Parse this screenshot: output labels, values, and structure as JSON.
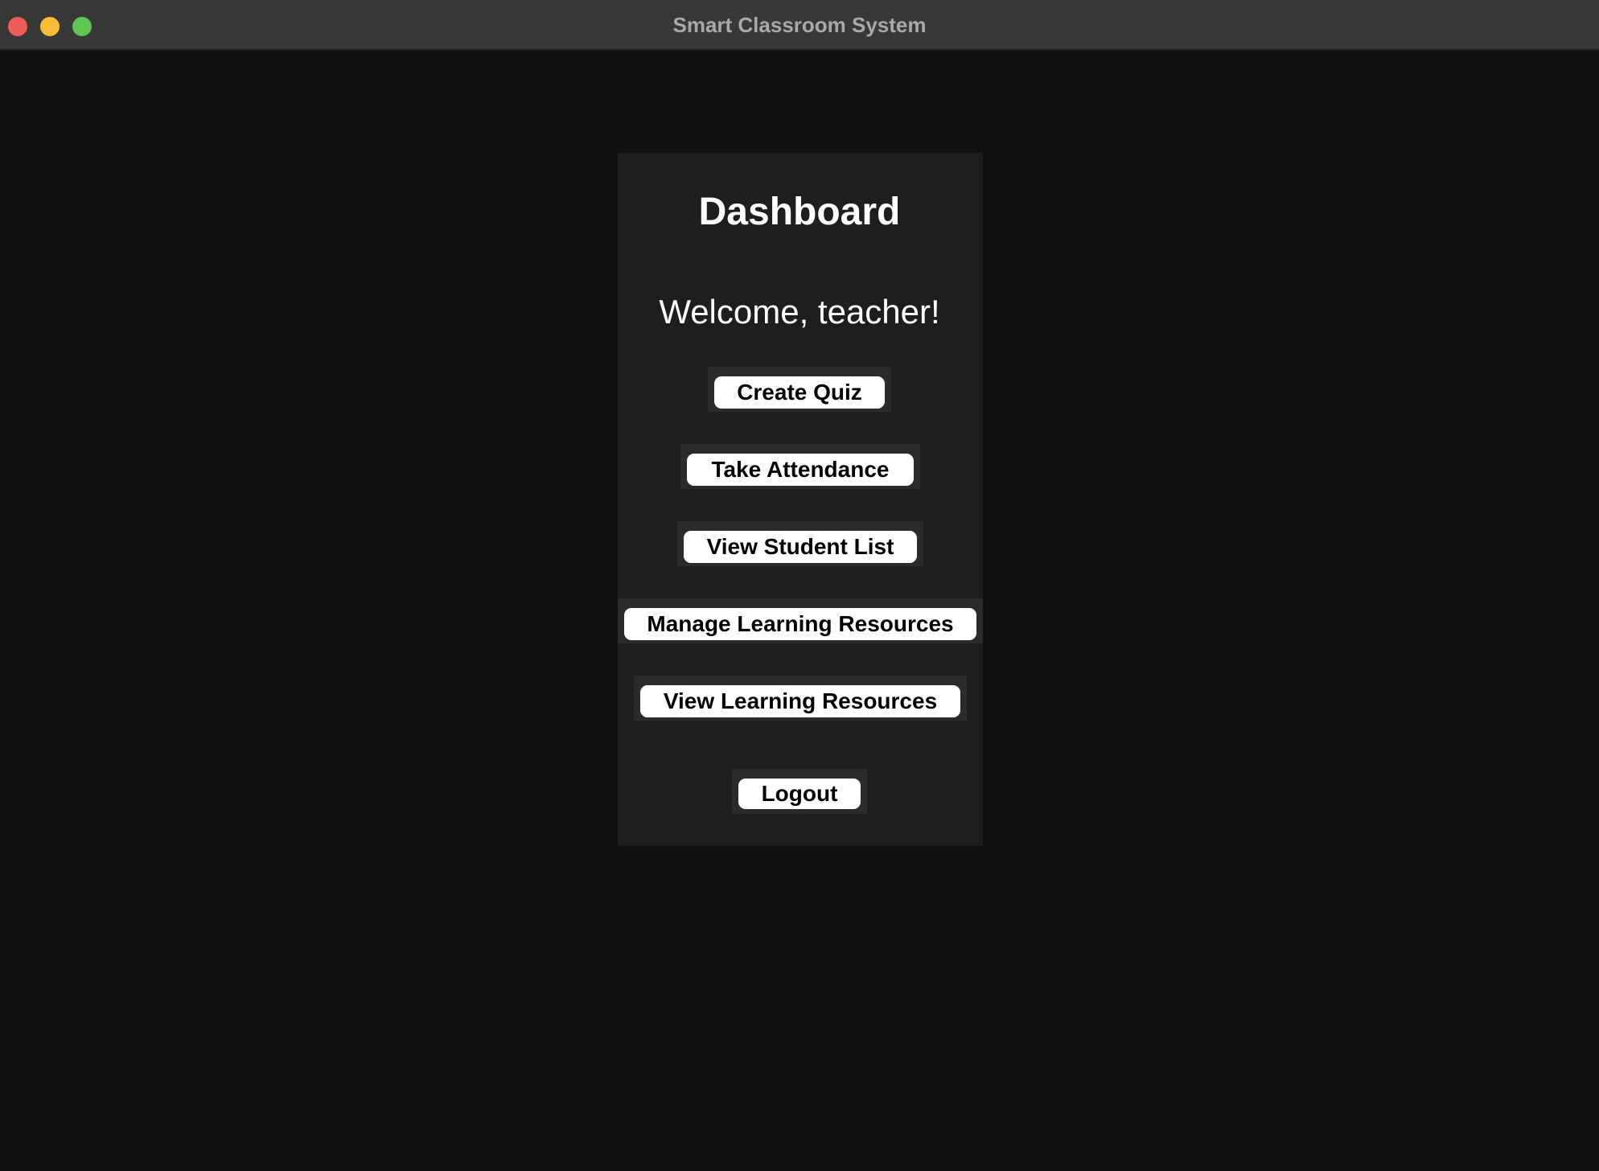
{
  "window": {
    "title": "Smart Classroom System"
  },
  "dashboard": {
    "heading": "Dashboard",
    "welcome": "Welcome, teacher!",
    "buttons": {
      "create_quiz": "Create Quiz",
      "take_attendance": "Take Attendance",
      "view_student_list": "View Student List",
      "manage_learning_resources": "Manage Learning Resources",
      "view_learning_resources": "View Learning Resources",
      "logout": "Logout"
    }
  },
  "colors": {
    "background": "#111111",
    "panel": "#1e1e1e",
    "button": "#ffffff",
    "button_frame": "#2b2b2b",
    "close": "#ee5d57",
    "minimize": "#f6bd3b",
    "maximize": "#5fc454"
  }
}
